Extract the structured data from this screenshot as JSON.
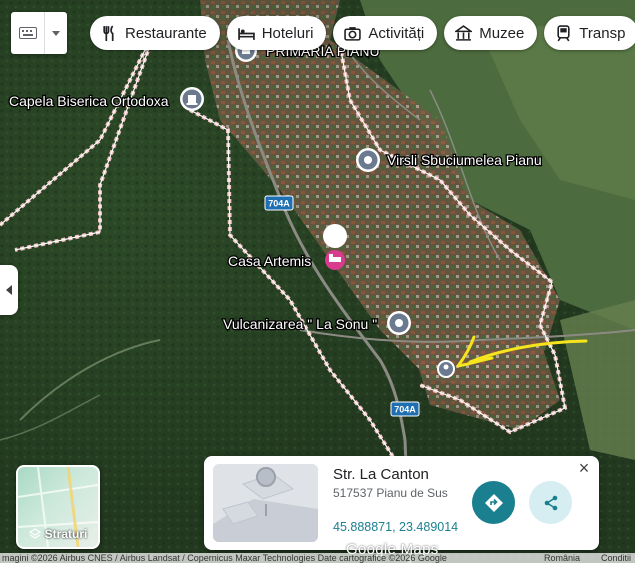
{
  "toolbar": {
    "chips": [
      {
        "label": "Restaurante",
        "icon": "fork-knife-icon"
      },
      {
        "label": "Hoteluri",
        "icon": "bed-icon"
      },
      {
        "label": "Activități",
        "icon": "camera-icon"
      },
      {
        "label": "Muzee",
        "icon": "museum-icon"
      },
      {
        "label": "Transp",
        "icon": "train-icon"
      }
    ]
  },
  "map": {
    "places": {
      "primaria": "PRIMARIA PIANU",
      "capela": "Capela Biserica Ortodoxa",
      "virsli": "Virsli Sbuciumelea Pianu",
      "artemis": "Casa Artemis",
      "vulcanizarea": "Vulcanizarea \" La Sonu \""
    },
    "road_shields": [
      "704A",
      "704A"
    ],
    "colors": {
      "boundary": "#e8a0a0",
      "marker_teal": "#1a7f8e",
      "hotel_pink": "#d93c8f",
      "arrow": "#f6e51c"
    }
  },
  "layers_button": {
    "label": "Straturi",
    "icon": "layers-icon"
  },
  "place_card": {
    "title": "Str. La Canton",
    "address": "517537 Pianu de Sus",
    "coordinates": "45.888871, 23.489014",
    "close": "×",
    "directions_icon": "directions-icon",
    "share_icon": "share-icon"
  },
  "attribution": {
    "text": "magini ©2026 Airbus CNES / Airbus Landsat / Copernicus Maxar Technologies Date cartografice ©2026 Google",
    "region": "România",
    "terms": "Conditii",
    "logo": "Google Maps"
  }
}
